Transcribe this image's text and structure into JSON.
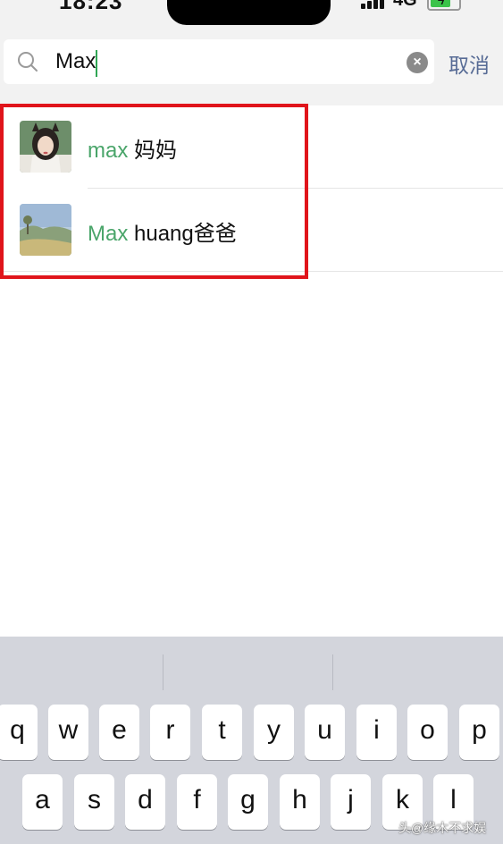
{
  "status_bar": {
    "time": "18:23",
    "network": "4G"
  },
  "search": {
    "query": "Max",
    "cancel_label": "取消"
  },
  "results": [
    {
      "match": "max",
      "rest": " 妈妈"
    },
    {
      "match": "Max",
      "rest": " huang爸爸"
    }
  ],
  "keyboard": {
    "row1": [
      "q",
      "w",
      "e",
      "r",
      "t",
      "y",
      "u",
      "i",
      "o",
      "p"
    ],
    "row2": [
      "a",
      "s",
      "d",
      "f",
      "g",
      "h",
      "j",
      "k",
      "l"
    ]
  },
  "watermark": "头@缘木不求娱",
  "colors": {
    "match_green": "#4aa56a",
    "highlight_red": "#e0141b",
    "cancel_blue": "#576b95"
  }
}
